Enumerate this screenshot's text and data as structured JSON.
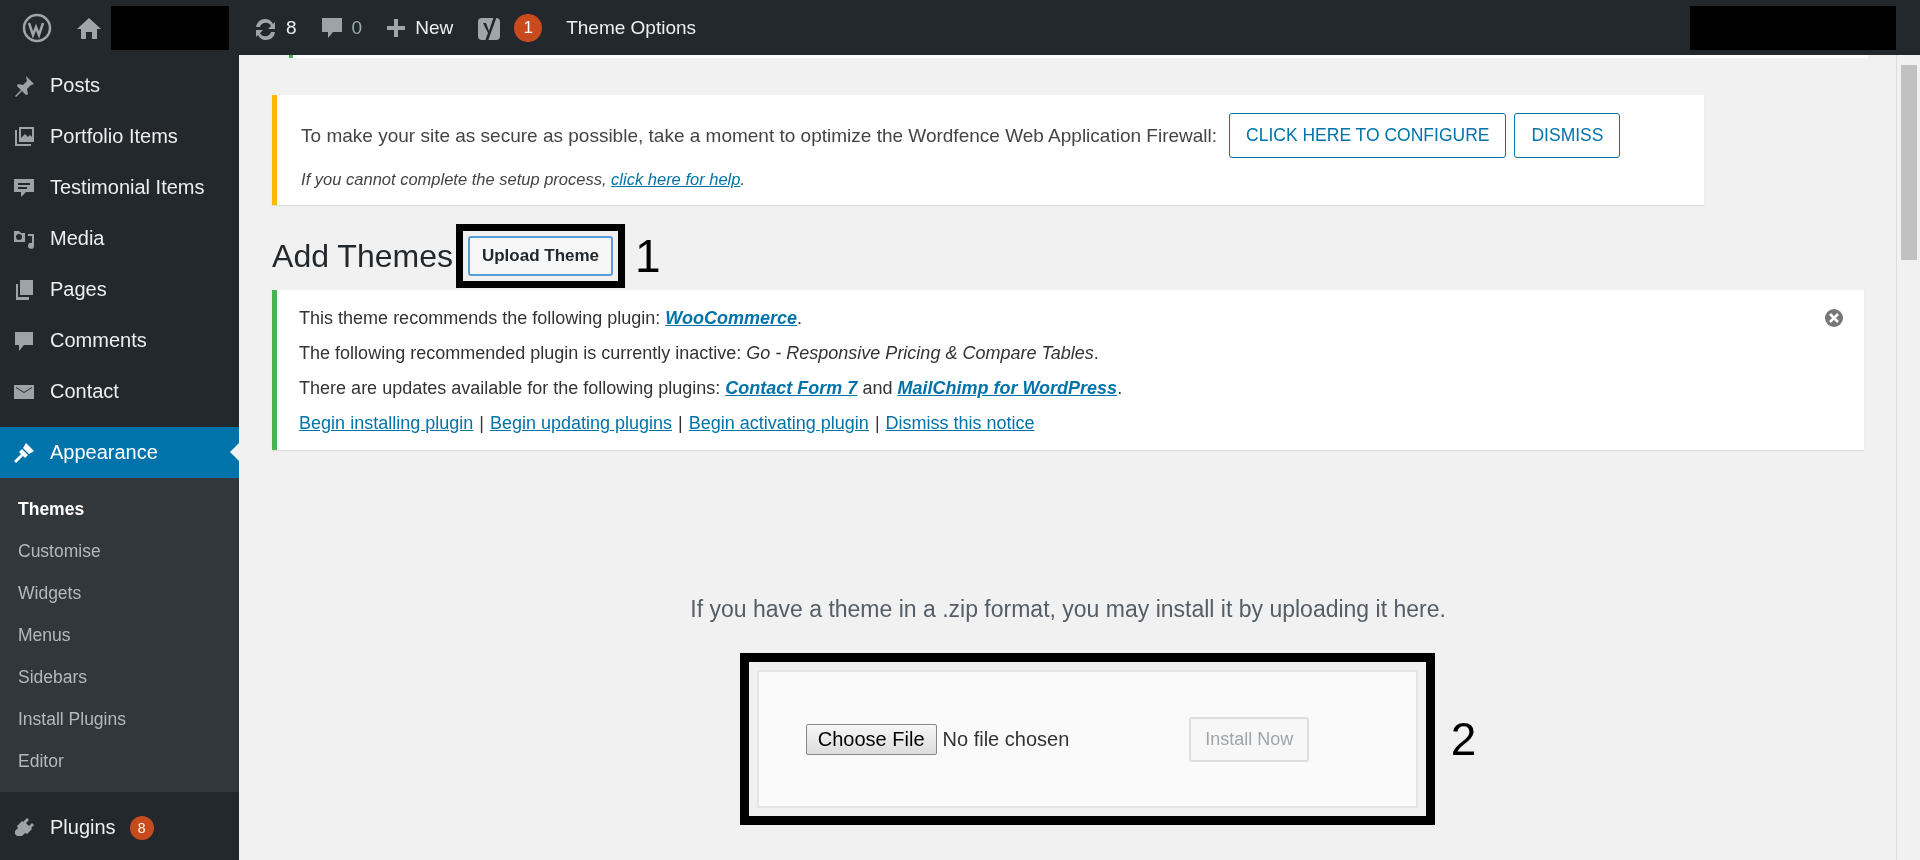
{
  "admin_bar": {
    "updates_count": "8",
    "comments_count": "0",
    "new_label": "New",
    "seo_badge": "1",
    "theme_options": "Theme Options"
  },
  "sidebar": {
    "items": [
      {
        "label": "Posts",
        "selected": false
      },
      {
        "label": "Portfolio Items",
        "selected": false
      },
      {
        "label": "Testimonial Items",
        "selected": false
      },
      {
        "label": "Media",
        "selected": false
      },
      {
        "label": "Pages",
        "selected": false
      },
      {
        "label": "Comments",
        "selected": false
      },
      {
        "label": "Contact",
        "selected": false
      },
      {
        "label": "Appearance",
        "selected": true,
        "children": [
          {
            "label": "Themes",
            "selected": true
          },
          {
            "label": "Customise",
            "selected": false
          },
          {
            "label": "Widgets",
            "selected": false
          },
          {
            "label": "Menus",
            "selected": false
          },
          {
            "label": "Sidebars",
            "selected": false
          },
          {
            "label": "Install Plugins",
            "selected": false
          },
          {
            "label": "Editor",
            "selected": false
          }
        ]
      },
      {
        "label": "Plugins",
        "selected": false,
        "badge": "8"
      }
    ]
  },
  "firewall_notice": {
    "message": "To make your site as secure as possible, take a moment to optimize the Wordfence Web Application Firewall:",
    "buttons": [
      "CLICK HERE TO CONFIGURE",
      "DISMISS"
    ],
    "help_text": "If you cannot complete the setup process, ",
    "help_link": "click here for help",
    "help_end": "."
  },
  "heading": {
    "title": "Add Themes",
    "button": "Upload Theme",
    "annotation": "1"
  },
  "plugin_notice": {
    "lines": [
      [
        {
          "kind": "text",
          "text": "This theme recommends the following plugin: "
        },
        {
          "kind": "link",
          "text": "WooCommerce"
        },
        {
          "kind": "text",
          "text": "."
        }
      ],
      [
        {
          "kind": "text",
          "text": "The following recommended plugin is currently inactive: "
        },
        {
          "kind": "em",
          "text": "Go - Responsive Pricing & Compare Tables"
        },
        {
          "kind": "text",
          "text": "."
        }
      ],
      [
        {
          "kind": "text",
          "text": "There are updates available for the following plugins: "
        },
        {
          "kind": "link",
          "text": "Contact Form 7"
        },
        {
          "kind": "text",
          "text": " and "
        },
        {
          "kind": "link",
          "text": "MailChimp for WordPress"
        },
        {
          "kind": "text",
          "text": "."
        }
      ]
    ],
    "actions": [
      {
        "kind": "link",
        "text": "Begin installing plugin"
      },
      {
        "kind": "separator",
        "text": "|"
      },
      {
        "kind": "link",
        "text": "Begin updating plugins"
      },
      {
        "kind": "separator",
        "text": "|"
      },
      {
        "kind": "link",
        "text": "Begin activating plugin"
      },
      {
        "kind": "separator",
        "text": "|"
      },
      {
        "kind": "link",
        "text": "Dismiss this notice"
      }
    ]
  },
  "upload": {
    "description": "If you have a theme in a .zip format, you may install it by uploading it here.",
    "choose_file": "Choose File",
    "file_status": "No file chosen",
    "install_button": "Install Now",
    "install_disabled": true,
    "annotation": "2"
  }
}
